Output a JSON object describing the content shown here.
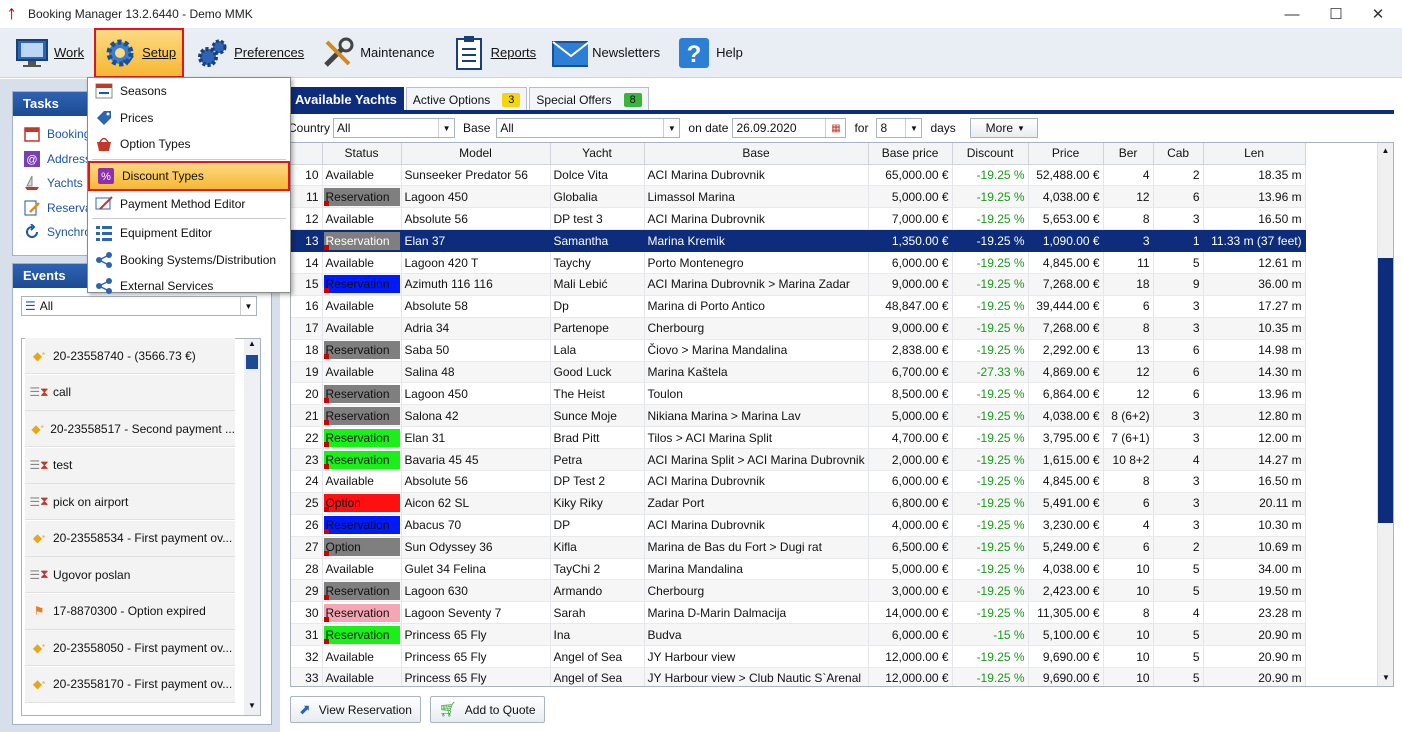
{
  "window": {
    "title": "Booking Manager 13.2.6440 - Demo MMK",
    "minimize": "—",
    "maximize": "☐",
    "close": "✕"
  },
  "toolbar": {
    "items": [
      {
        "label": "Work",
        "icon": "monitor-icon"
      },
      {
        "label": "Setup",
        "icon": "gear-icon",
        "active": true
      },
      {
        "label": "Preferences",
        "icon": "gears-icon"
      },
      {
        "label": "Maintenance",
        "icon": "wrench-icon"
      },
      {
        "label": "Reports",
        "icon": "clipboard-icon"
      },
      {
        "label": "Newsletters",
        "icon": "envelope-icon"
      },
      {
        "label": "Help",
        "icon": "help-icon"
      }
    ]
  },
  "setup_menu": {
    "items": [
      {
        "label": "Seasons",
        "icon": "calendar-icon"
      },
      {
        "label": "Prices",
        "icon": "tag-icon"
      },
      {
        "label": "Option Types",
        "icon": "basket-icon"
      },
      {
        "label": "Discount Types",
        "icon": "percent-icon",
        "highlighted": true
      },
      {
        "label": "Payment Method Editor",
        "icon": "payment-icon"
      },
      {
        "label": "Equipment Editor",
        "icon": "list-icon"
      },
      {
        "label": "Booking Systems/Distribution",
        "icon": "share-icon"
      },
      {
        "label": "External Services",
        "icon": "share-icon"
      }
    ]
  },
  "tasks": {
    "title": "Tasks",
    "items": [
      {
        "label": "Bookings",
        "icon": "calendar-icon"
      },
      {
        "label": "Addresses",
        "icon": "at-icon"
      },
      {
        "label": "Yachts",
        "icon": "yacht-icon"
      },
      {
        "label": "Reservations",
        "icon": "edit-icon"
      },
      {
        "label": "Synchronize",
        "icon": "sync-icon"
      }
    ]
  },
  "events": {
    "title": "Events",
    "filter": "All",
    "items": [
      {
        "text": "20-23558740 -  (3566.73 €)",
        "icon": "coin-icon"
      },
      {
        "text": "call",
        "icon": "task-icon"
      },
      {
        "text": "20-23558517 - Second payment ...",
        "icon": "coin-icon"
      },
      {
        "text": "test",
        "icon": "task-icon"
      },
      {
        "text": "pick on airport",
        "icon": "task-icon"
      },
      {
        "text": "20-23558534 - First payment ov...",
        "icon": "coin-icon"
      },
      {
        "text": "Ugovor poslan",
        "icon": "task-icon"
      },
      {
        "text": "17-8870300 - Option expired",
        "icon": "flag-icon"
      },
      {
        "text": "20-23558050 - First payment ov...",
        "icon": "coin-icon"
      },
      {
        "text": "20-23558170 - First payment ov...",
        "icon": "coin-icon"
      }
    ]
  },
  "tabs": [
    {
      "label": "Available Yachts",
      "active": true
    },
    {
      "label": "Active Options",
      "badge": "3",
      "badge_color": "#f5d60c"
    },
    {
      "label": "Special Offers",
      "badge": "8",
      "badge_color": "#3cb43c"
    }
  ],
  "filters": {
    "country_label": "Country",
    "country": "All",
    "base_label": "Base",
    "base": "All",
    "date_label": "on date",
    "date": "26.09.2020",
    "for_label": "for",
    "days_value": "8",
    "days_label": "days",
    "more": "More"
  },
  "columns": [
    "",
    "Status",
    "Model",
    "Yacht",
    "Base",
    "Base price",
    "Discount",
    "Price",
    "Ber",
    "Cab",
    "Len"
  ],
  "status_colors": {
    "Reservation": "#7f7f7f",
    "Reservation-blue": "#0019ff",
    "Reservation-green": "#18f018",
    "Reservation-pink": "#f4a6b4",
    "Option": "#ff1010",
    "Option-gray": "#7f7f7f"
  },
  "rows": [
    [
      "10",
      "Available",
      "",
      "Sunseeker Predator 56",
      "Dolce Vita",
      "ACI Marina Dubrovnik",
      "65,000.00 €",
      "-19.25 %",
      "52,488.00 €",
      "4",
      "2",
      "18.35 m"
    ],
    [
      "11",
      "Reservation",
      "#7f7f7f",
      "Lagoon 450",
      "Globalia",
      "Limassol Marina",
      "5,000.00 €",
      "-19.25 %",
      "4,038.00 €",
      "12",
      "6",
      "13.96 m"
    ],
    [
      "12",
      "Available",
      "",
      "Absolute 56",
      "DP test 3",
      "ACI Marina Dubrovnik",
      "7,000.00 €",
      "-19.25 %",
      "5,653.00 €",
      "8",
      "3",
      "16.50 m"
    ],
    [
      "13",
      "Reservation",
      "#7f7f7f",
      "Elan 37",
      "Samantha",
      "Marina Kremik",
      "1,350.00 €",
      "-19.25 %",
      "1,090.00 €",
      "3",
      "1",
      "11.33 m (37 feet)"
    ],
    [
      "14",
      "Available",
      "",
      "Lagoon 420 T",
      "Taychy",
      "Porto Montenegro",
      "6,000.00 €",
      "-19.25 %",
      "4,845.00 €",
      "11",
      "5",
      "12.61 m"
    ],
    [
      "15",
      "Reservation",
      "#0019ff",
      "Azimuth 116 116",
      "Mali Lebić",
      "ACI Marina Dubrovnik > Marina Zadar",
      "9,000.00 €",
      "-19.25 %",
      "7,268.00 €",
      "18",
      "9",
      "36.00 m"
    ],
    [
      "16",
      "Available",
      "",
      "Absolute 58",
      "Dp",
      "Marina di Porto Antico",
      "48,847.00 €",
      "-19.25 %",
      "39,444.00 €",
      "6",
      "3",
      "17.27 m"
    ],
    [
      "17",
      "Available",
      "",
      "Adria 34",
      "Partenope",
      "Cherbourg",
      "9,000.00 €",
      "-19.25 %",
      "7,268.00 €",
      "8",
      "3",
      "10.35 m"
    ],
    [
      "18",
      "Reservation",
      "#7f7f7f",
      "Saba 50",
      "Lala",
      "Čiovo > Marina Mandalina",
      "2,838.00 €",
      "-19.25 %",
      "2,292.00 €",
      "13",
      "6",
      "14.98 m"
    ],
    [
      "19",
      "Available",
      "",
      "Salina 48",
      "Good Luck",
      "Marina Kaštela",
      "6,700.00 €",
      "-27.33 %",
      "4,869.00 €",
      "12",
      "6",
      "14.30 m"
    ],
    [
      "20",
      "Reservation",
      "#7f7f7f",
      "Lagoon 450",
      "The Heist",
      "Toulon",
      "8,500.00 €",
      "-19.25 %",
      "6,864.00 €",
      "12",
      "6",
      "13.96 m"
    ],
    [
      "21",
      "Reservation",
      "#7f7f7f",
      "Salona 42",
      "Sunce Moje",
      "Nikiana Marina > Marina Lav",
      "5,000.00 €",
      "-19.25 %",
      "4,038.00 €",
      "8 (6+2)",
      "3",
      "12.80 m"
    ],
    [
      "22",
      "Reservation",
      "#18f018",
      "Elan 31",
      "Brad Pitt",
      "Tilos > ACI Marina Split",
      "4,700.00 €",
      "-19.25 %",
      "3,795.00 €",
      "7 (6+1)",
      "3",
      "12.00 m"
    ],
    [
      "23",
      "Reservation",
      "#18f018",
      "Bavaria 45 45",
      "Petra",
      "ACI Marina Split > ACI Marina Dubrovnik",
      "2,000.00 €",
      "-19.25 %",
      "1,615.00 €",
      "10 8+2",
      "4",
      "14.27 m"
    ],
    [
      "24",
      "Available",
      "",
      "Absolute 56",
      "DP Test 2",
      "ACI Marina Dubrovnik",
      "6,000.00 €",
      "-19.25 %",
      "4,845.00 €",
      "8",
      "3",
      "16.50 m"
    ],
    [
      "25",
      "Option",
      "#ff1010",
      "Aicon 62 SL",
      "Kiky Riky",
      "Zadar Port",
      "6,800.00 €",
      "-19.25 %",
      "5,491.00 €",
      "6",
      "3",
      "20.11 m"
    ],
    [
      "26",
      "Reservation",
      "#0019ff",
      "Abacus 70",
      "DP",
      "ACI Marina Dubrovnik",
      "4,000.00 €",
      "-19.25 %",
      "3,230.00 €",
      "4",
      "3",
      "10.30 m"
    ],
    [
      "27",
      "Option",
      "#7f7f7f",
      "Sun Odyssey 36",
      "Kifla",
      "Marina de Bas du Fort > Dugi rat",
      "6,500.00 €",
      "-19.25 %",
      "5,249.00 €",
      "6",
      "2",
      "10.69 m"
    ],
    [
      "28",
      "Available",
      "",
      "Gulet 34 Felina",
      "TayChi 2",
      "Marina Mandalina",
      "5,000.00 €",
      "-19.25 %",
      "4,038.00 €",
      "10",
      "5",
      "34.00 m"
    ],
    [
      "29",
      "Reservation",
      "#7f7f7f",
      "Lagoon 630",
      "Armando",
      "Cherbourg",
      "3,000.00 €",
      "-19.25 %",
      "2,423.00 €",
      "10",
      "5",
      "19.50 m"
    ],
    [
      "30",
      "Reservation",
      "#f4a6b4",
      "Lagoon Seventy 7",
      "Sarah",
      "Marina D-Marin Dalmacija",
      "14,000.00 €",
      "-19.25 %",
      "11,305.00 €",
      "8",
      "4",
      "23.28 m"
    ],
    [
      "31",
      "Reservation",
      "#18f018",
      "Princess 65 Fly",
      "Ina",
      "Budva",
      "6,000.00 €",
      "-15 %",
      "5,100.00 €",
      "10",
      "5",
      "20.90 m"
    ],
    [
      "32",
      "Available",
      "",
      "Princess 65 Fly",
      "Angel of Sea",
      "JY Harbour view",
      "12,000.00 €",
      "-19.25 %",
      "9,690.00 €",
      "10",
      "5",
      "20.90 m"
    ],
    [
      "33",
      "Available",
      "",
      "Princess 65 Fly",
      "Angel of Sea",
      "JY Harbour view > Club Nautic S`Arenal",
      "12,000.00 €",
      "-19.25 %",
      "9,690.00 €",
      "10",
      "5",
      "20.90 m"
    ]
  ],
  "selected_row": "13",
  "buttons": {
    "view_reservation": "View Reservation",
    "add_to_quote": "Add to Quote"
  }
}
